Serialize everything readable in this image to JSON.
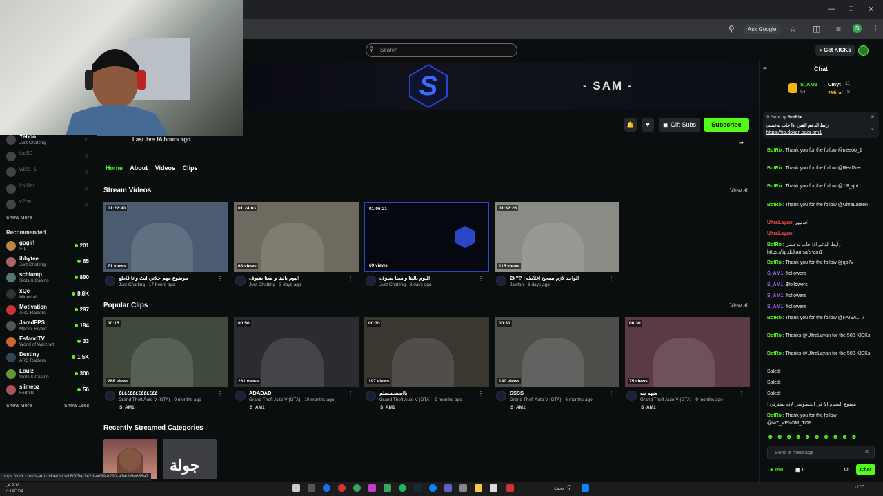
{
  "browser": {
    "ask_google": "Ask Google",
    "profile_initial": "S",
    "status_url": "https://kick.com/s-am1/videos/ce18005a-342d-4d89-8290-a34db5e636a7"
  },
  "header": {
    "search_placeholder": "Search",
    "get_kicks": "Get KICKs"
  },
  "channel": {
    "banner_name": "- SAM -",
    "last_live": "Last live 16 hours ago",
    "gift_subs": "Gift Subs",
    "subscribe": "Subscribe"
  },
  "tabs": [
    "Home",
    "About",
    "Videos",
    "Clips"
  ],
  "sidebar": {
    "following": [
      {
        "name": "Yehoo",
        "cat": "Just Chatting"
      },
      {
        "name": "icq50",
        "cat": ""
      },
      {
        "name": "wbls_1",
        "cat": ""
      },
      {
        "name": "lmMzx",
        "cat": ""
      },
      {
        "name": "v2rw",
        "cat": ""
      }
    ],
    "show_more": "Show More",
    "recommended_label": "Recommended",
    "recommended": [
      {
        "name": "gogirl",
        "cat": "IRL",
        "viewers": "201"
      },
      {
        "name": "ibbytee",
        "cat": "Just Chatting",
        "viewers": "65"
      },
      {
        "name": "schlump",
        "cat": "Slots & Casino",
        "viewers": "890"
      },
      {
        "name": "xQc",
        "cat": "Minecraft",
        "viewers": "8.8K"
      },
      {
        "name": "Motivation",
        "cat": "ARC Raiders",
        "viewers": "297"
      },
      {
        "name": "JaredFPS",
        "cat": "Marvel Rivals",
        "viewers": "194"
      },
      {
        "name": "EsfandTV",
        "cat": "World of Warcraft",
        "viewers": "33"
      },
      {
        "name": "Destiny",
        "cat": "ARC Raiders",
        "viewers": "1.5K"
      },
      {
        "name": "Loulz",
        "cat": "Slots & Casino",
        "viewers": "300"
      },
      {
        "name": "slimeoz",
        "cat": "Fortnite",
        "viewers": "56"
      }
    ],
    "show_more_2": "Show More",
    "show_less": "Show Less"
  },
  "stream_videos": {
    "title": "Stream Videos",
    "view_all": "View all",
    "items": [
      {
        "dur": "01:22:40",
        "views": "71 views",
        "title": "موضوع مهم خلاني ابث وانا قاطع",
        "meta": "Just Chatting · 17 hours ago",
        "thumb": "#4b5c70"
      },
      {
        "dur": "01:24:03",
        "views": "68 views",
        "title": "اليوم بالينا و معنا ضيوف",
        "meta": "Just Chatting · 3 days ago",
        "thumb": "#6f6a5f"
      },
      {
        "dur": "01:06:21",
        "views": "69 views",
        "title": "اليوم بالينا و معنا ضيوف",
        "meta": "Just Chatting · 3 days ago",
        "thumb": "#060810"
      },
      {
        "dur": "01:32:26",
        "views": "115 views",
        "title": "2k?? | الواحد لازم يصحح اغلاطه",
        "meta": "Jawlah · 6 days ago",
        "thumb": "#8b8b86"
      }
    ]
  },
  "popular_clips": {
    "title": "Popular Clips",
    "view_all": "View all",
    "items": [
      {
        "dur": "00:15",
        "views": "288 views",
        "title": "٤٤٤٤٤٤٤٤٤٤٤٤٤٤",
        "meta": "Grand Theft Auto V (GTA) · 9 months ago",
        "chan": "S_AM1",
        "thumb": "#3f4a3c"
      },
      {
        "dur": "00:50",
        "views": "261 views",
        "title": "ADADAD",
        "meta": "Grand Theft Auto V (GTA) · 10 months ago",
        "chan": "S_AM1",
        "thumb": "#2a2c30"
      },
      {
        "dur": "00:30",
        "views": "197 views",
        "title": "يااسسسسلم",
        "meta": "Grand Theft Auto V (GTA) · 9 months ago",
        "chan": "S_AM1",
        "thumb": "#3a3630"
      },
      {
        "dur": "00:30",
        "views": "140 views",
        "title": "SSSS",
        "meta": "Grand Theft Auto V (GTA) · 6 months ago",
        "chan": "S_AM1",
        "thumb": "#4d4d4a"
      },
      {
        "dur": "00:30",
        "views": "75 views",
        "title": "هيهه بيه",
        "meta": "Grand Theft Auto V (GTA) · 9 months ago",
        "chan": "S_AM1",
        "thumb": "#5a3a44"
      }
    ]
  },
  "categories": {
    "title": "Recently Streamed Categories",
    "jawlah_text": "جولة"
  },
  "chat": {
    "title": "Chat",
    "leader1": "S_AM1",
    "leader1_n": "54",
    "leader2": "Cmyt",
    "leader2_n": "11",
    "leader3": "2Miral",
    "leader3_n": "8",
    "pinned_by": "Sent by",
    "pinned_user": "BotRix",
    "pinned_text": "رابط الدعم الفني اذا حاب تدعمني",
    "pinned_link": "https://tip.dokan.sa/s-am1",
    "messages": [
      {
        "user": "BotRix",
        "text": "Thank you for the follow @rreeoo_1",
        "type": "bot"
      },
      {
        "user": "BotRix",
        "text": "Thank you for the follow @Real7reo",
        "type": "bot"
      },
      {
        "user": "BotRix",
        "text": "Thank you for the follow @1R_qht",
        "type": "bot"
      },
      {
        "user": "BotRix",
        "text": "Thank you for the follow @UltraLateen",
        "type": "bot"
      },
      {
        "user": "UltraLayan",
        "text": "فوليوز!",
        "type": "red"
      },
      {
        "user": "UltraLayan",
        "text": "",
        "type": "red"
      },
      {
        "user": "BotRix",
        "text": "رابط الدعم اذا حاب تدعمني https://tip.dokan.sa/s-am1",
        "type": "bot"
      },
      {
        "user": "BotRix",
        "text": "Thank you for the follow @qo7v",
        "type": "bot"
      },
      {
        "user": "S_AM1",
        "text": "!followers",
        "type": "user"
      },
      {
        "user": "S_AM1",
        "text": "$followers",
        "type": "user"
      },
      {
        "user": "S_AM1",
        "text": "!followers",
        "type": "user"
      },
      {
        "user": "S_AM1",
        "text": "!followers",
        "type": "user"
      },
      {
        "user": "BotRix",
        "text": "Thank you for the follow @FAISAL_7",
        "type": "bot"
      },
      {
        "user": "BotRix",
        "text": "Thanks @UltraLayan for the 500 KICKs!",
        "type": "bot"
      },
      {
        "user": "BotRix",
        "text": "Thanks @UltraLayan for the 500 KICKs!",
        "type": "bot"
      },
      {
        "user": "Saled",
        "text": "",
        "type": "plain"
      },
      {
        "user": "Saled",
        "text": "",
        "type": "plain"
      },
      {
        "user": "Saled",
        "text": "",
        "type": "plain"
      },
      {
        "user": "",
        "text": "ممنوع السبام الا في الخصوصي لانه يسترني",
        "type": "plain"
      },
      {
        "user": "BotRix",
        "text": "Thank you for the follow @M7_VENOM_TOP",
        "type": "bot"
      }
    ],
    "input_placeholder": "Send a message",
    "kicks": "150",
    "subs": "0",
    "chat_btn": "Chat"
  },
  "taskbar": {
    "search": "بحث",
    "time": "٥:١٨ ص",
    "date": "٢٠٢٥/١٢/٥",
    "weather": "١٣°C"
  }
}
